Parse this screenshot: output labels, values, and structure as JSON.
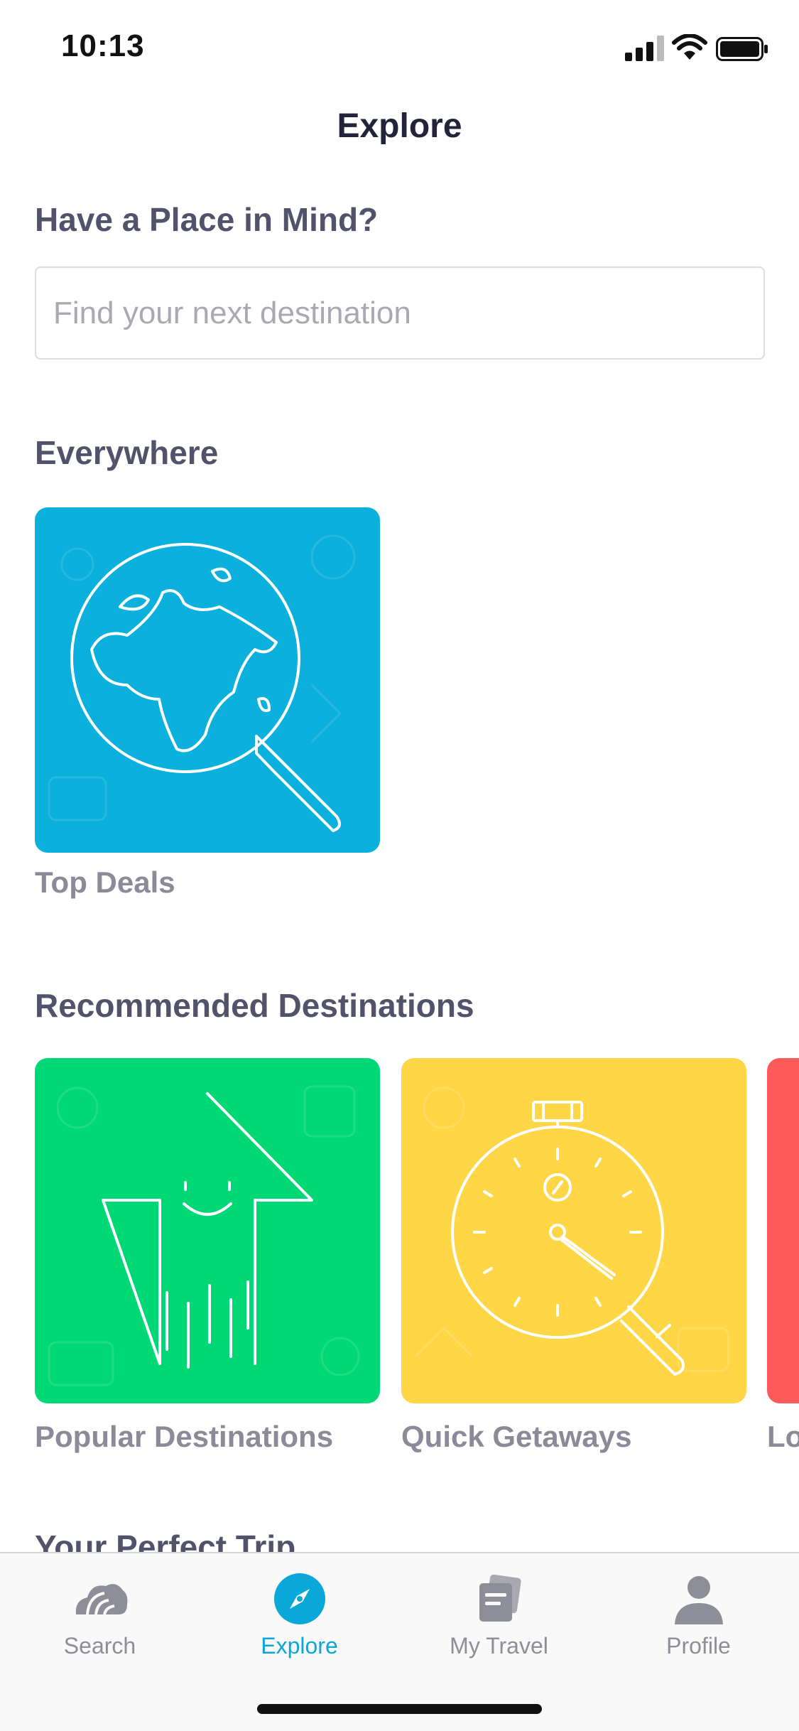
{
  "status_bar": {
    "time": "10:13"
  },
  "header": {
    "title": "Explore"
  },
  "search": {
    "heading": "Have a Place in Mind?",
    "placeholder": "Find your next destination",
    "value": ""
  },
  "everywhere": {
    "heading": "Everywhere",
    "tiles": [
      {
        "label": "Top Deals",
        "color": "#0bb0dd",
        "icon": "globe-search-icon"
      }
    ]
  },
  "recommended": {
    "heading": "Recommended Destinations",
    "tiles": [
      {
        "label": "Popular Destinations",
        "color": "#00d775",
        "icon": "arrow-up-icon"
      },
      {
        "label": "Quick Getaways",
        "color": "#ffd645",
        "icon": "stopwatch-icon"
      },
      {
        "label": "Lo",
        "color": "#ff5a5a",
        "icon": ""
      }
    ]
  },
  "next_section": {
    "heading": "Your Perfect Trip"
  },
  "tab_bar": {
    "active_color": "#0aa8d8",
    "inactive_color": "#8e8e98",
    "tabs": [
      {
        "label": "Search",
        "icon": "cloud-logo-icon"
      },
      {
        "label": "Explore",
        "icon": "compass-icon",
        "active": true
      },
      {
        "label": "My Travel",
        "icon": "documents-icon"
      },
      {
        "label": "Profile",
        "icon": "person-icon"
      }
    ]
  }
}
